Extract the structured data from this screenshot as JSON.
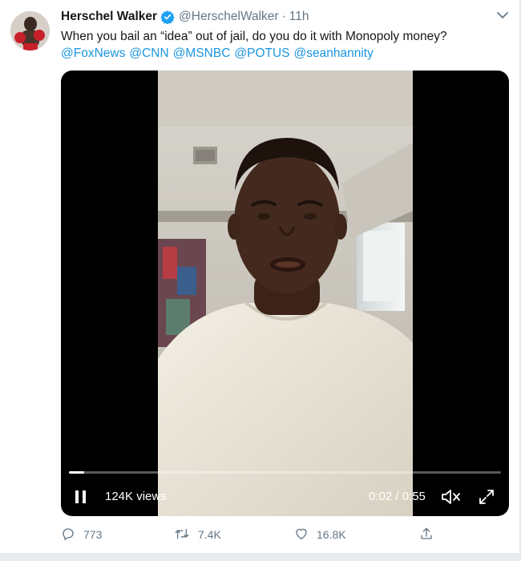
{
  "tweet": {
    "author_name": "Herschel Walker",
    "handle": "@HerschelWalker",
    "separator": "·",
    "time": "11h",
    "text": "When you bail an “idea” out of jail, do you do it with Monopoly money?",
    "mentions": [
      "@FoxNews",
      "@CNN",
      "@MSNBC",
      "@POTUS",
      "@seanhannity"
    ]
  },
  "video": {
    "views": "124K views",
    "time_readout": "0:02 / 0:55",
    "progress_fraction": 0.036,
    "state": "playing"
  },
  "actions": {
    "reply_count": "773",
    "retweet_count": "7.4K",
    "like_count": "16.8K"
  },
  "icons": {
    "verified": "verified-badge-icon",
    "caret": "chevron-down-icon",
    "pause": "pause-icon",
    "mute": "volume-muted-icon",
    "fullscreen": "fullscreen-icon",
    "reply": "reply-icon",
    "retweet": "retweet-icon",
    "like": "heart-icon",
    "share": "share-icon"
  },
  "colors": {
    "accent": "#1b95e0",
    "secondary_text": "#657786",
    "primary_text": "#14171a"
  }
}
